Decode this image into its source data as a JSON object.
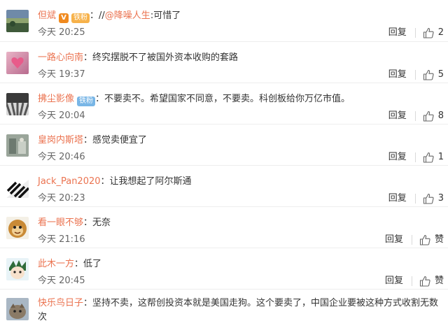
{
  "comments": [
    {
      "user": "但斌",
      "badge_v": "V",
      "badge_fan": "铁粉",
      "text": "//@降噪人生:可惜了",
      "mention": "@降噪人生",
      "time": "今天 20:25",
      "reply": "回复",
      "likes": "2"
    },
    {
      "user": "一路心向南",
      "text": "终究摆脱不了被国外资本收购的套路",
      "time": "今天 19:37",
      "reply": "回复",
      "likes": "5"
    },
    {
      "user": "拂尘影像",
      "badge_fan": "铁粉",
      "text": "不要卖不。希望国家不同意，不要卖。科创板给你万亿市值。",
      "time": "今天 20:04",
      "reply": "回复",
      "likes": "8"
    },
    {
      "user": "皇岗内斯塔",
      "text": "感觉卖便宜了",
      "time": "今天 20:46",
      "reply": "回复",
      "likes": "1"
    },
    {
      "user": "Jack_Pan2020",
      "text": "让我想起了阿尔斯通",
      "time": "今天 20:23",
      "reply": "回复",
      "likes": "3"
    },
    {
      "user": "看一眼不够",
      "text": "无奈",
      "time": "今天 21:16",
      "reply": "回复",
      "likes": "赞"
    },
    {
      "user": "此木一方",
      "text": "低了",
      "time": "今天 20:45",
      "reply": "回复",
      "likes": "赞"
    },
    {
      "user": "快乐鸟日子",
      "text": "坚持不卖，这帮创投资本就是美国走狗。这个要卖了，中国企业要被这种方式收割无数次"
    }
  ],
  "colors": {
    "username": "#eb7350",
    "fan_badge": "#f7b24a",
    "v_badge": "#f08a1f",
    "blue_badge": "#79b6e6"
  }
}
